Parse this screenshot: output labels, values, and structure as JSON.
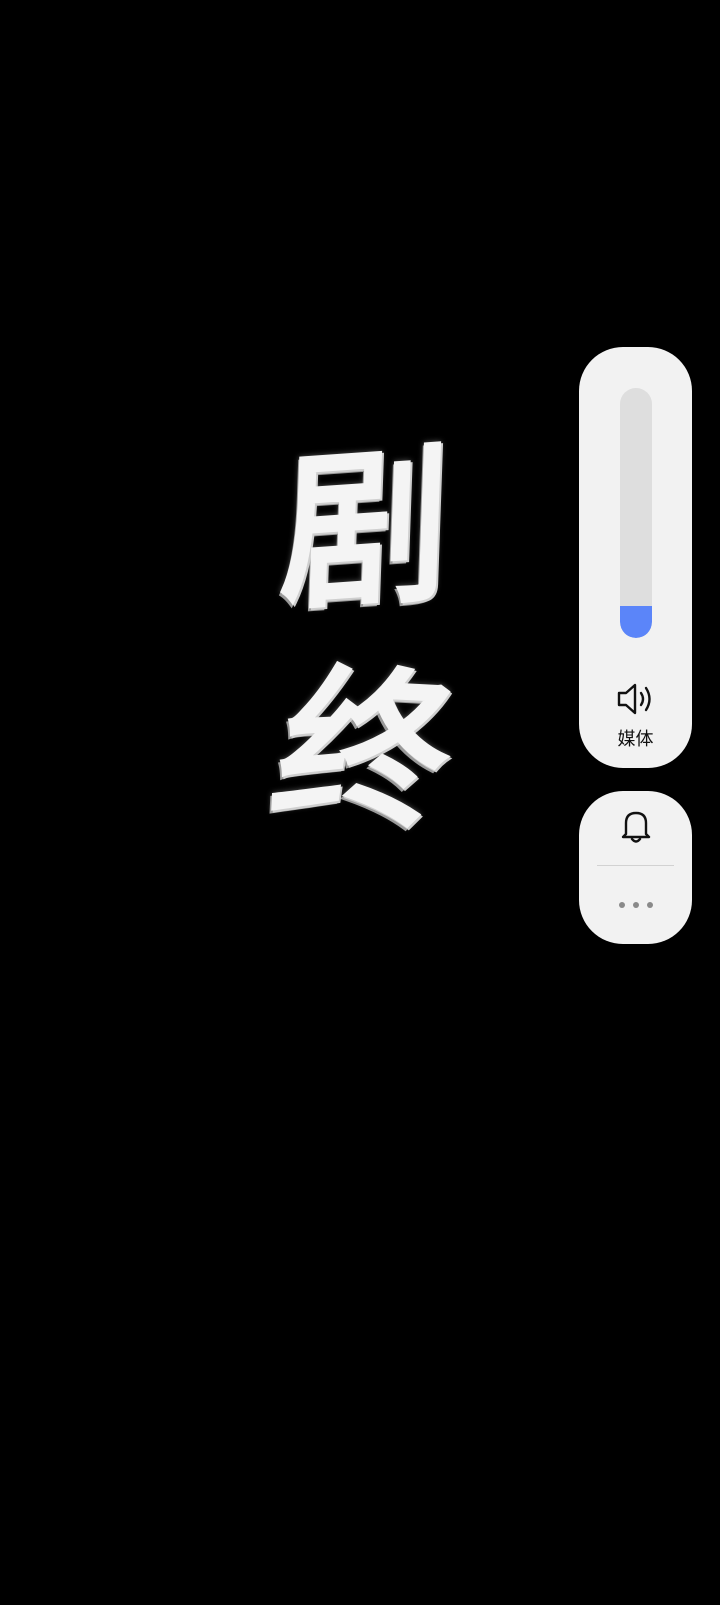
{
  "video": {
    "ending_text_line1": "剧",
    "ending_text_line2": "终"
  },
  "volume_panel": {
    "level": 0.13,
    "stream_label": "媒体",
    "fill_color": "#5b85f9",
    "track_color": "#dedede",
    "icon": "speaker-icon"
  },
  "ringer_panel": {
    "ringer_icon": "bell-icon",
    "more_icon": "more-horizontal-icon"
  },
  "colors": {
    "background": "#000000",
    "panel": "#f2f2f2"
  }
}
